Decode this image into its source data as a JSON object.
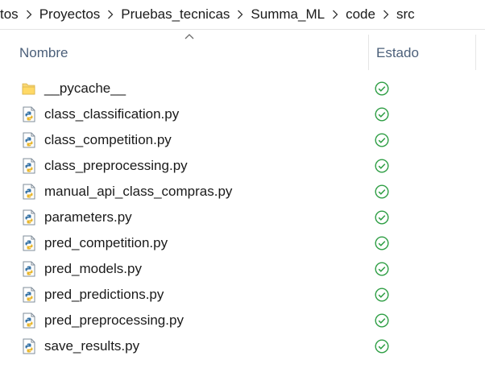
{
  "breadcrumb": {
    "items": [
      "tos",
      "Proyectos",
      "Pruebas_tecnicas",
      "Summa_ML",
      "code",
      "src"
    ]
  },
  "columns": {
    "name": "Nombre",
    "status": "Estado"
  },
  "files": [
    {
      "name": "__pycache__",
      "type": "folder",
      "status": "synced"
    },
    {
      "name": "class_classification.py",
      "type": "python",
      "status": "synced"
    },
    {
      "name": "class_competition.py",
      "type": "python",
      "status": "synced"
    },
    {
      "name": "class_preprocessing.py",
      "type": "python",
      "status": "synced"
    },
    {
      "name": "manual_api_class_compras.py",
      "type": "python",
      "status": "synced"
    },
    {
      "name": "parameters.py",
      "type": "python",
      "status": "synced"
    },
    {
      "name": "pred_competition.py",
      "type": "python",
      "status": "synced"
    },
    {
      "name": "pred_models.py",
      "type": "python",
      "status": "synced"
    },
    {
      "name": "pred_predictions.py",
      "type": "python",
      "status": "synced"
    },
    {
      "name": "pred_preprocessing.py",
      "type": "python",
      "status": "synced"
    },
    {
      "name": "save_results.py",
      "type": "python",
      "status": "synced"
    }
  ],
  "colors": {
    "status_green": "#2e9e44",
    "header_text": "#4c607a",
    "folder_yellow": "#f8d775"
  }
}
